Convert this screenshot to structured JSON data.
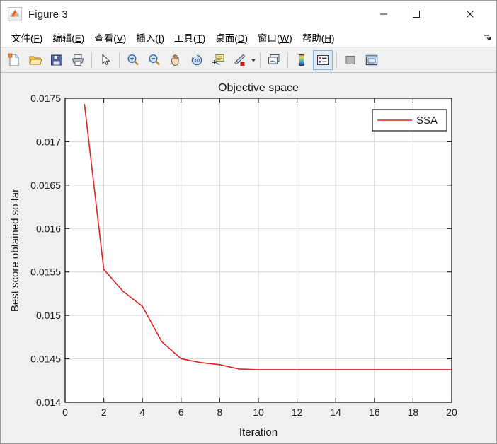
{
  "window": {
    "title": "Figure 3",
    "app_icon": "matlab-membrane-icon",
    "controls": {
      "minimize": "–",
      "maximize": "□",
      "close": "✕"
    }
  },
  "menubar": {
    "items": [
      {
        "name": "file",
        "label": "文件(F)",
        "text": "文件(",
        "key": "F",
        "tail": ")"
      },
      {
        "name": "edit",
        "label": "编辑(E)",
        "text": "编辑(",
        "key": "E",
        "tail": ")"
      },
      {
        "name": "view",
        "label": "查看(V)",
        "text": "查看(",
        "key": "V",
        "tail": ")"
      },
      {
        "name": "insert",
        "label": "插入(I)",
        "text": "插入(",
        "key": "I",
        "tail": ")"
      },
      {
        "name": "tools",
        "label": "工具(T)",
        "text": "工具(",
        "key": "T",
        "tail": ")"
      },
      {
        "name": "desktop",
        "label": "桌面(D)",
        "text": "桌面(",
        "key": "D",
        "tail": ")"
      },
      {
        "name": "window",
        "label": "窗口(W)",
        "text": "窗口(",
        "key": "W",
        "tail": ")"
      },
      {
        "name": "help",
        "label": "帮助(H)",
        "text": "帮助(",
        "key": "H",
        "tail": ")"
      }
    ],
    "overflow_icon": "overflow-arrow-icon"
  },
  "toolbar": {
    "buttons": [
      {
        "name": "new-figure",
        "icon": "new-document-icon"
      },
      {
        "name": "open-file",
        "icon": "open-folder-icon"
      },
      {
        "name": "save-figure",
        "icon": "save-floppy-icon"
      },
      {
        "name": "print-figure",
        "icon": "printer-icon"
      },
      {
        "name": "edit-plot",
        "icon": "arrow-pointer-icon"
      },
      {
        "name": "zoom-in",
        "icon": "zoom-in-magnifier-icon"
      },
      {
        "name": "zoom-out",
        "icon": "zoom-out-magnifier-icon"
      },
      {
        "name": "pan",
        "icon": "hand-pan-icon"
      },
      {
        "name": "rotate-3d",
        "icon": "rotate-3d-icon"
      },
      {
        "name": "insert-data-tip",
        "icon": "data-cursor-icon"
      },
      {
        "name": "brush-data",
        "icon": "brush-paint-icon"
      },
      {
        "name": "link-plot",
        "icon": "link-plot-icon"
      },
      {
        "name": "insert-colorbar",
        "icon": "colorbar-icon"
      },
      {
        "name": "insert-legend",
        "icon": "legend-icon"
      },
      {
        "name": "hide-plot-tools",
        "icon": "hide-plot-tools-icon"
      },
      {
        "name": "show-plot-tools",
        "icon": "show-plot-tools-icon"
      }
    ],
    "active_button": "insert-legend"
  },
  "chart_data": {
    "type": "line",
    "title": "Objective space",
    "xlabel": "Iteration",
    "ylabel": "Best score obtained so far",
    "xlim": [
      0,
      20
    ],
    "ylim": [
      0.014,
      0.0175
    ],
    "xticks": [
      0,
      2,
      4,
      6,
      8,
      10,
      12,
      14,
      16,
      18,
      20
    ],
    "xticklabels": [
      "0",
      "2",
      "4",
      "6",
      "8",
      "10",
      "12",
      "14",
      "16",
      "18",
      "20"
    ],
    "yticks": [
      0.014,
      0.0145,
      0.015,
      0.0155,
      0.016,
      0.0165,
      0.017,
      0.0175
    ],
    "yticklabels": [
      "0.014",
      "0.0145",
      "0.015",
      "0.0155",
      "0.016",
      "0.0165",
      "0.017",
      "0.0175"
    ],
    "grid": true,
    "legend": {
      "position": "top-right",
      "entries": [
        "SSA"
      ]
    },
    "series": [
      {
        "name": "SSA",
        "color": "#e02020",
        "x": [
          1,
          2,
          3,
          4,
          5,
          6,
          7,
          8,
          9,
          10,
          11,
          12,
          13,
          14,
          15,
          16,
          17,
          18,
          19,
          20
        ],
        "values": [
          0.017385,
          0.01548,
          0.015228,
          0.015055,
          0.014648,
          0.014452,
          0.014408,
          0.014383,
          0.014333,
          0.014325,
          0.014325,
          0.014325,
          0.014325,
          0.014325,
          0.014325,
          0.014325,
          0.014325,
          0.014325,
          0.014325,
          0.014325
        ]
      }
    ],
    "axes_bgcolor": "#ffffff",
    "figure_bgcolor": "#f0f0f0",
    "grid_color": "#d4d4d4"
  }
}
